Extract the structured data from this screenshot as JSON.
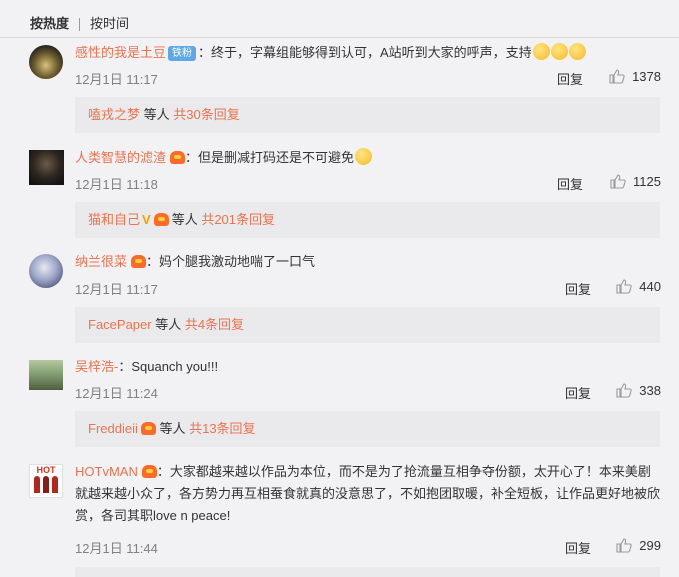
{
  "tabs": {
    "hot": "按热度",
    "time": "按时间"
  },
  "comments": [
    {
      "user": "感性的我是土豆",
      "fan_badge": "铁粉",
      "text": "：终于，字幕组能够得到认可，A站听到大家的呼声，支持",
      "time": "12月1日 11:17",
      "reply": "回复",
      "likes": "1378",
      "sub_user": "嗑戎之梦",
      "sub_mid": " 等人 ",
      "sub_count": "共30条回复"
    },
    {
      "user": "人类智慧的滤渣",
      "text": "：但是删减打码还是不可避免",
      "time": "12月1日 11:18",
      "reply": "回复",
      "likes": "1125",
      "sub_user": "猫和自己",
      "sub_mid": "等人 ",
      "sub_count": "共201条回复"
    },
    {
      "user": "纳兰很菜",
      "text": "：妈个腿我激动地喘了一口气",
      "time": "12月1日 11:17",
      "reply": "回复",
      "likes": "440",
      "sub_user": "FacePaper",
      "sub_mid": " 等人 ",
      "sub_count": "共4条回复"
    },
    {
      "user": "吴梓浩-",
      "text": "：Squanch you!!!",
      "time": "12月1日 11:24",
      "reply": "回复",
      "likes": "338",
      "sub_user": "Freddieii",
      "sub_mid": " 等人 ",
      "sub_count": "共13条回复"
    },
    {
      "user": "HOTvMAN",
      "text": "：大家都越来越以作品为本位，而不是为了抢流量互相争夺份额，太开心了！本来美剧就越来越小众了，各方势力再互相蚕食就真的没意思了，不如抱团取暖，补全短板，让作品更好地被欣赏，各司其职love n peace!",
      "time": "12月1日 11:44",
      "reply": "回复",
      "likes": "299",
      "avatar_text": "HOT"
    }
  ],
  "colors": {
    "accent": "#eb7350",
    "fan_badge": "#5fa8e8",
    "background": "#f2f2f5",
    "subbox": "#eaeaec"
  }
}
